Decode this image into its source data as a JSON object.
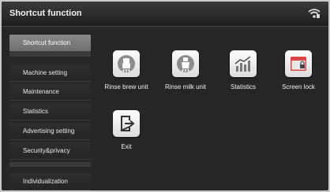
{
  "header": {
    "title": "Shortcut function",
    "status_icon": "wifi-icon"
  },
  "sidebar": {
    "items": [
      {
        "label": "Shortcut function",
        "active": true
      },
      {
        "label": "Machine setting",
        "active": false
      },
      {
        "label": "Maintenance",
        "active": false
      },
      {
        "label": "Statistics",
        "active": false
      },
      {
        "label": "Advertising setting",
        "active": false
      },
      {
        "label": "Security&privacy",
        "active": false
      },
      {
        "label": "Individualization",
        "active": false
      }
    ]
  },
  "shortcuts": [
    {
      "label": "Rinse brew unit",
      "icon": "rinse-brew-unit-icon"
    },
    {
      "label": "Rinse milk unit",
      "icon": "rinse-milk-unit-icon"
    },
    {
      "label": "Statistics",
      "icon": "statistics-chart-icon"
    },
    {
      "label": "Screen lock",
      "icon": "screen-lock-icon"
    },
    {
      "label": "Exit",
      "icon": "exit-icon"
    }
  ]
}
